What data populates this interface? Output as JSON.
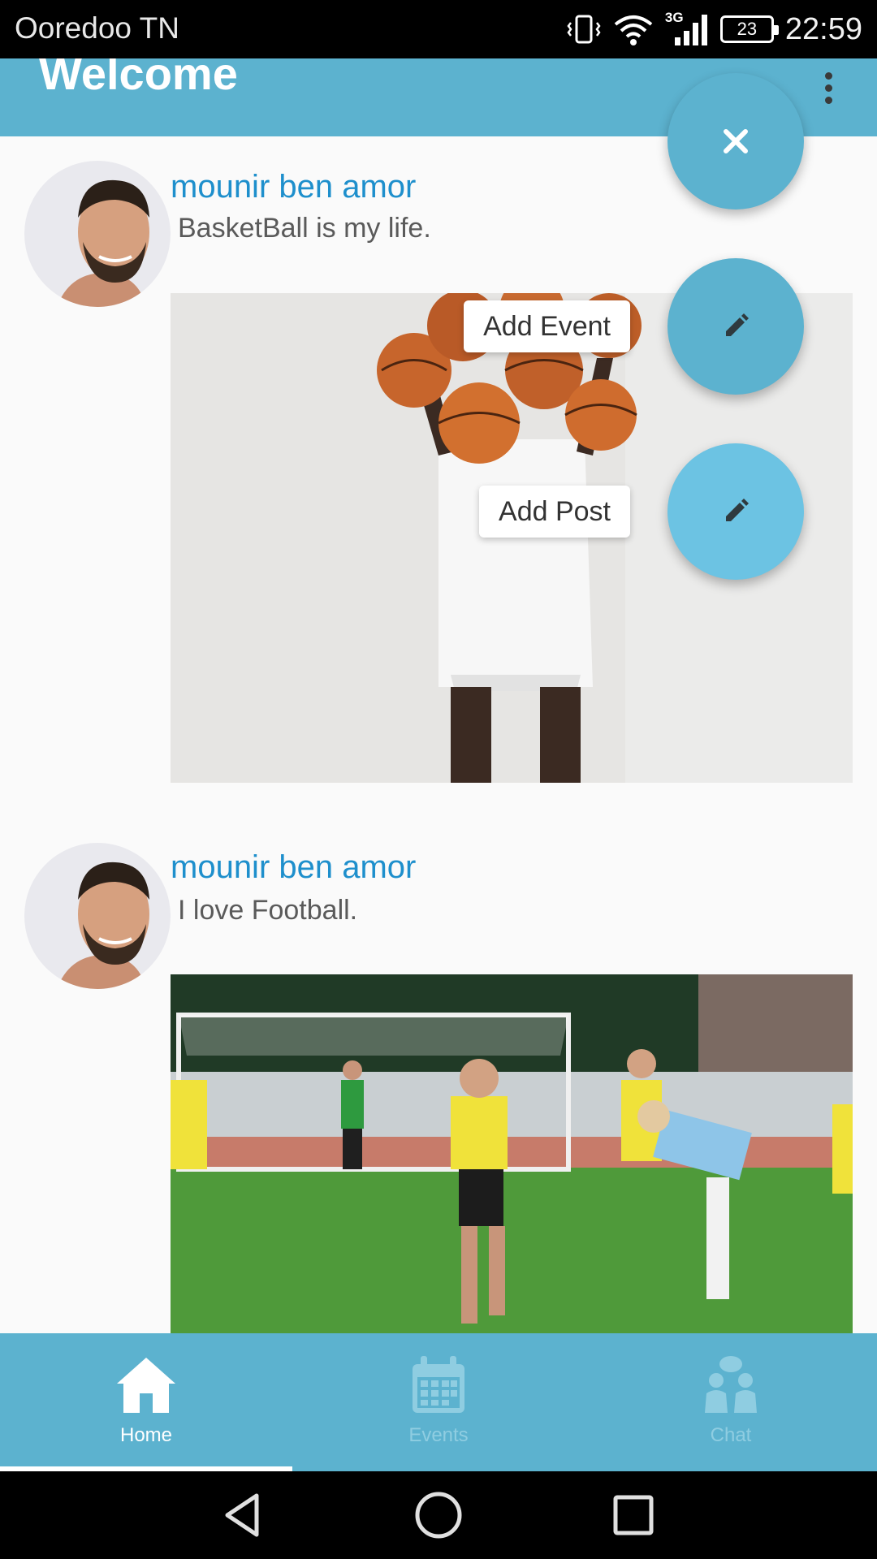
{
  "status_bar": {
    "carrier": "Ooredoo TN",
    "network": "3G",
    "battery": "23",
    "time": "22:59"
  },
  "app_bar": {
    "title": "Welcome"
  },
  "posts": [
    {
      "author": "mounir ben amor",
      "text": "BasketBall is my life.",
      "image": "basketball-player-photo"
    },
    {
      "author": "mounir ben amor",
      "text": "I love Football.",
      "image": "football-match-photo"
    }
  ],
  "fab_menu": {
    "add_event_label": "Add Event",
    "add_post_label": "Add Post"
  },
  "bottom_nav": {
    "items": [
      {
        "label": "Home",
        "icon": "home-icon",
        "active": true
      },
      {
        "label": "Events",
        "icon": "calendar-icon",
        "active": false
      },
      {
        "label": "Chat",
        "icon": "people-chat-icon",
        "active": false
      }
    ]
  },
  "colors": {
    "primary": "#5cb2cf",
    "author_name": "#1e8fcc",
    "fab_light": "#6cc3e3"
  }
}
